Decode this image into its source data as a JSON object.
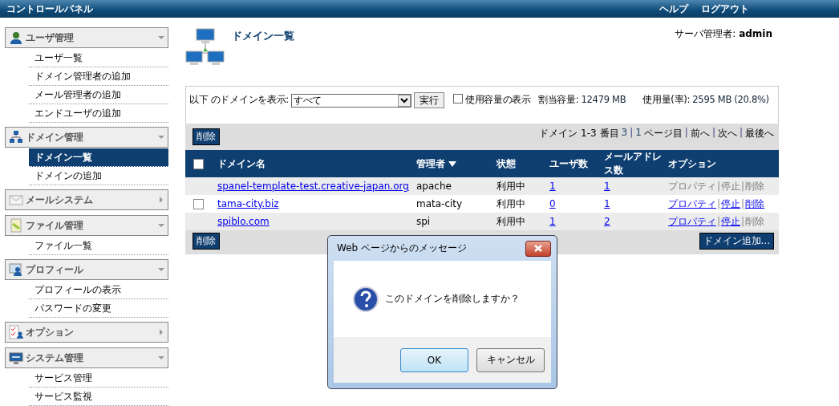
{
  "header": {
    "title": "コントロールパネル",
    "links": [
      "ヘルプ",
      "ログアウト"
    ]
  },
  "sidebar": {
    "sections": [
      {
        "kind": "user",
        "title": "ユーザ管理",
        "expanded": true,
        "items": [
          {
            "label": "ユーザ一覧",
            "selected": false
          },
          {
            "label": "ドメイン管理者の追加",
            "selected": false
          },
          {
            "label": "メール管理者の追加",
            "selected": false
          },
          {
            "label": "エンドユーザの追加",
            "selected": false
          }
        ]
      },
      {
        "kind": "network",
        "title": "ドメイン管理",
        "expanded": true,
        "items": [
          {
            "label": "ドメイン一覧",
            "selected": true
          },
          {
            "label": "ドメインの追加",
            "selected": false
          }
        ]
      },
      {
        "kind": "mail",
        "title": "メールシステム",
        "expanded": false
      },
      {
        "kind": "file",
        "title": "ファイル管理",
        "expanded": true,
        "items": [
          {
            "label": "ファイル一覧",
            "selected": false
          }
        ]
      },
      {
        "kind": "profile",
        "title": "プロフィール",
        "expanded": true,
        "items": [
          {
            "label": "プロフィールの表示",
            "selected": false
          },
          {
            "label": "パスワードの変更",
            "selected": false
          }
        ]
      },
      {
        "kind": "options",
        "title": "オプション",
        "expanded": false
      },
      {
        "kind": "system",
        "title": "システム管理",
        "expanded": true,
        "items": [
          {
            "label": "サービス管理",
            "selected": false
          },
          {
            "label": "サービス監視",
            "selected": false
          }
        ]
      }
    ]
  },
  "page": {
    "title": "ドメイン一覧",
    "server_admin_label": "サーバ管理者:",
    "server_admin": "admin"
  },
  "filter": {
    "label": "以下 のドメインを表示:",
    "value": "すべて",
    "run_button": "実行",
    "usage_checkbox": {
      "label": "使用容量の表示",
      "checked": false
    },
    "quota_label": "割当容量:",
    "quota_value": "12479 MB",
    "usage_label": "使用量(率):",
    "usage_value": "2595 MB (20.8%)"
  },
  "delete_button": "削除",
  "pager": [
    {
      "kind": "text",
      "text": "ドメイン 1-3 番目"
    },
    {
      "kind": "count",
      "text": "3"
    },
    {
      "kind": "sep",
      "text": "|"
    },
    {
      "kind": "count",
      "text": "1"
    },
    {
      "kind": "text",
      "text": "ページ目"
    },
    {
      "kind": "sep",
      "text": "|"
    },
    {
      "kind": "text",
      "text": "前へ"
    },
    {
      "kind": "sep",
      "text": "|"
    },
    {
      "kind": "text",
      "text": "次へ"
    },
    {
      "kind": "sep",
      "text": "|"
    },
    {
      "kind": "text",
      "text": "最後へ"
    }
  ],
  "table": {
    "select_all": {
      "checked": false
    },
    "columns": [
      {
        "label": "ドメイン名",
        "sorted": false
      },
      {
        "label": "管理者",
        "sorted": true
      },
      {
        "label": "状態",
        "sorted": false
      },
      {
        "label": "ユーザ数",
        "sorted": false
      },
      {
        "label": "メールアドレス数",
        "sorted": false
      },
      {
        "label": "オプション",
        "sorted": false
      }
    ],
    "rows": [
      {
        "domain": "spanel-template-test.creative-japan.org",
        "admin": "apache",
        "status": "利用中",
        "users": "1",
        "mail_addresses": "1",
        "options": [
          {
            "kind": "link",
            "label": "プロパティ",
            "disabled": true
          },
          {
            "kind": "sep",
            "label": "|"
          },
          {
            "kind": "link",
            "label": "停止",
            "disabled": true
          },
          {
            "kind": "sep",
            "label": "|"
          },
          {
            "kind": "link",
            "label": "削除",
            "disabled": true
          }
        ]
      },
      {
        "checkbox": {
          "checked": false
        },
        "domain": "tama-city.biz",
        "admin": "mata-city",
        "status": "利用中",
        "users": "0",
        "mail_addresses": "1",
        "options": [
          {
            "kind": "link",
            "label": "プロパティ",
            "disabled": false
          },
          {
            "kind": "sep",
            "label": "|"
          },
          {
            "kind": "link",
            "label": "停止",
            "disabled": false
          },
          {
            "kind": "sep",
            "label": "|"
          },
          {
            "kind": "link",
            "label": "削除",
            "disabled": false
          }
        ]
      },
      {
        "domain": "spiblo.com",
        "admin": "spi",
        "status": "利用中",
        "users": "1",
        "mail_addresses": "2",
        "options": [
          {
            "kind": "link",
            "label": "プロパティ",
            "disabled": false
          },
          {
            "kind": "sep",
            "label": "|"
          },
          {
            "kind": "link",
            "label": "停止",
            "disabled": false
          },
          {
            "kind": "sep",
            "label": "|"
          },
          {
            "kind": "link",
            "label": "削除",
            "disabled": true
          }
        ]
      }
    ]
  },
  "bottom_delete_button": "削除",
  "add_domain_button": "ドメイン追加...",
  "dialog": {
    "title": "Web ページからのメッセージ",
    "message": "このドメインを削除しますか？",
    "buttons": [
      {
        "label": "OK",
        "focused": true
      },
      {
        "label": "キャンセル",
        "focused": false
      }
    ]
  }
}
